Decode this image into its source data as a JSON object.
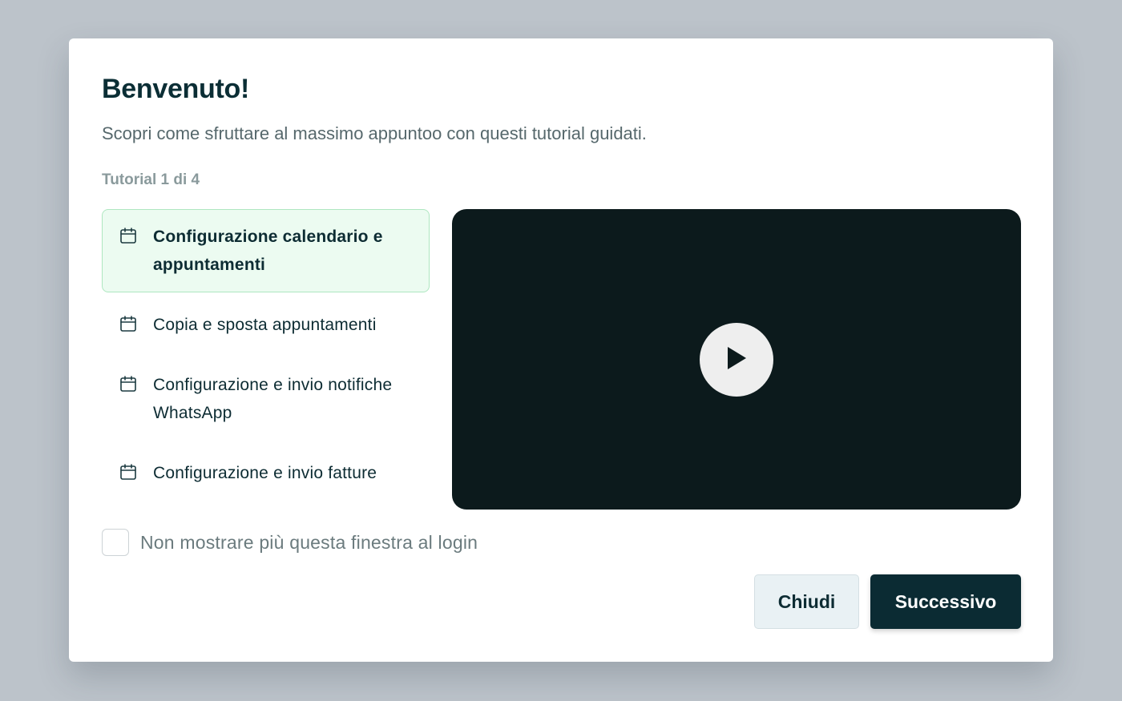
{
  "modal": {
    "title": "Benvenuto!",
    "subtitle": "Scopri come sfruttare al massimo appuntoo con questi tutorial guidati.",
    "progress": "Tutorial 1 di 4"
  },
  "tutorials": [
    {
      "label": "Configurazione calendario e appuntamenti",
      "icon": "calendar-icon",
      "active": true
    },
    {
      "label": "Copia e sposta appuntamenti",
      "icon": "calendar-icon",
      "active": false
    },
    {
      "label": "Configurazione e invio notifiche WhatsApp",
      "icon": "calendar-icon",
      "active": false
    },
    {
      "label": "Configurazione e invio fatture",
      "icon": "calendar-icon",
      "active": false
    }
  ],
  "video": {
    "icon": "play-icon"
  },
  "dont_show": {
    "label": "Non mostrare più questa finestra al login",
    "checked": false
  },
  "buttons": {
    "close_label": "Chiudi",
    "next_label": "Successivo"
  },
  "colors": {
    "primary": "#0b2b33",
    "active_bg": "#ecfbf1",
    "active_border": "#aee7c0",
    "video_bg": "#0c1a1c",
    "overlay": "#bcc3ca"
  }
}
